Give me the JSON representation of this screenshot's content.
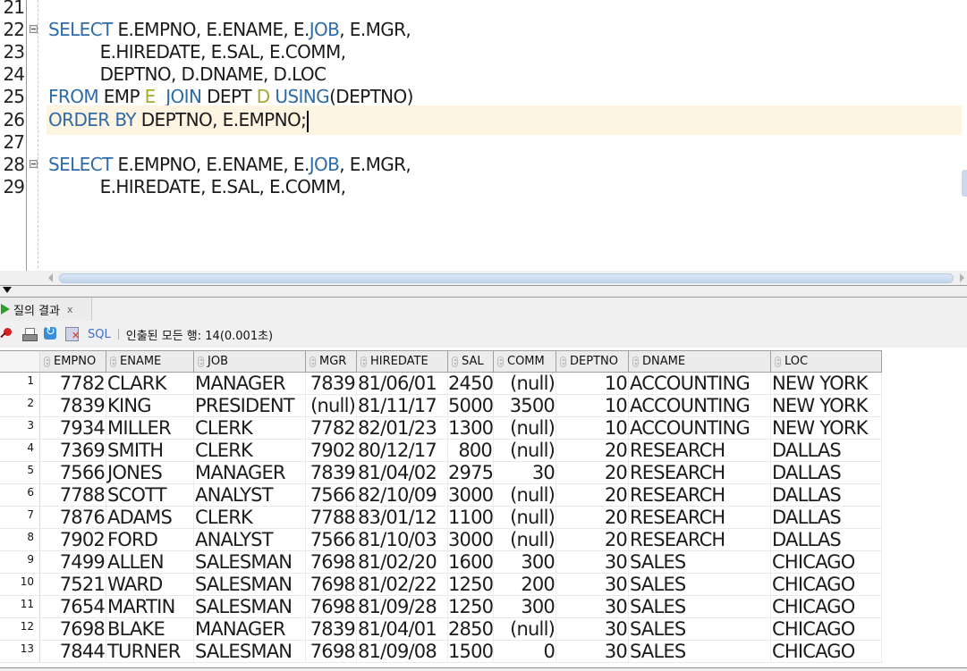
{
  "editor": {
    "lines": [
      {
        "no": "21",
        "fold": false,
        "tokens": []
      },
      {
        "no": "22",
        "fold": true,
        "tokens": [
          {
            "t": "SELECT",
            "k": "kw"
          },
          {
            "t": " E.EMPNO, E.ENAME, E.",
            "k": ""
          },
          {
            "t": "JOB",
            "k": "kw"
          },
          {
            "t": ", E.MGR,",
            "k": ""
          }
        ]
      },
      {
        "no": "23",
        "fold": false,
        "tokens": [
          {
            "t": "          E.HIREDATE, E.SAL, E.COMM,",
            "k": ""
          }
        ]
      },
      {
        "no": "24",
        "fold": false,
        "tokens": [
          {
            "t": "          DEPTNO, D.DNAME, D.LOC",
            "k": ""
          }
        ]
      },
      {
        "no": "25",
        "fold": false,
        "tokens": [
          {
            "t": "FROM",
            "k": "kw"
          },
          {
            "t": " EMP ",
            "k": ""
          },
          {
            "t": "E",
            "k": "alias"
          },
          {
            "t": "  ",
            "k": ""
          },
          {
            "t": "JOIN",
            "k": "kw"
          },
          {
            "t": " DEPT ",
            "k": ""
          },
          {
            "t": "D",
            "k": "alias"
          },
          {
            "t": " ",
            "k": ""
          },
          {
            "t": "USING",
            "k": "kw"
          },
          {
            "t": "(DEPTNO)",
            "k": ""
          }
        ]
      },
      {
        "no": "26",
        "fold": false,
        "current": true,
        "tokens": [
          {
            "t": "ORDER BY",
            "k": "kw"
          },
          {
            "t": " DEPTNO, E.EMPNO;",
            "k": ""
          }
        ]
      },
      {
        "no": "27",
        "fold": false,
        "tokens": []
      },
      {
        "no": "28",
        "fold": true,
        "tokens": [
          {
            "t": "SELECT",
            "k": "kw"
          },
          {
            "t": " E.EMPNO, E.ENAME, E.",
            "k": ""
          },
          {
            "t": "JOB",
            "k": "kw"
          },
          {
            "t": ", E.MGR,",
            "k": ""
          }
        ]
      },
      {
        "no": "29",
        "fold": false,
        "tokens": [
          {
            "t": "          E.HIREDATE, E.SAL, E.COMM,",
            "k": ""
          }
        ]
      }
    ]
  },
  "results": {
    "tab_label": "질의 결과",
    "tab_close": "x",
    "toolbar": {
      "icons": [
        "pin-icon",
        "print-icon",
        "refresh-icon",
        "cancel-fetch-icon"
      ],
      "sql_label": "SQL",
      "status": "인출된 모든 행: 14(0.001초)"
    },
    "columns": [
      "EMPNO",
      "ENAME",
      "JOB",
      "MGR",
      "HIREDATE",
      "SAL",
      "COMM",
      "DEPTNO",
      "DNAME",
      "LOC"
    ],
    "column_align": [
      "num",
      "txt",
      "txt",
      "num",
      "txt",
      "num",
      "num",
      "num",
      "txt",
      "txt"
    ],
    "rows": [
      [
        "1",
        "7782",
        "CLARK",
        "MANAGER",
        "7839",
        "81/06/01",
        "2450",
        "(null)",
        "10",
        "ACCOUNTING",
        "NEW YORK"
      ],
      [
        "2",
        "7839",
        "KING",
        "PRESIDENT",
        "(null)",
        "81/11/17",
        "5000",
        "3500",
        "10",
        "ACCOUNTING",
        "NEW YORK"
      ],
      [
        "3",
        "7934",
        "MILLER",
        "CLERK",
        "7782",
        "82/01/23",
        "1300",
        "(null)",
        "10",
        "ACCOUNTING",
        "NEW YORK"
      ],
      [
        "4",
        "7369",
        "SMITH",
        "CLERK",
        "7902",
        "80/12/17",
        "800",
        "(null)",
        "20",
        "RESEARCH",
        "DALLAS"
      ],
      [
        "5",
        "7566",
        "JONES",
        "MANAGER",
        "7839",
        "81/04/02",
        "2975",
        "30",
        "20",
        "RESEARCH",
        "DALLAS"
      ],
      [
        "6",
        "7788",
        "SCOTT",
        "ANALYST",
        "7566",
        "82/10/09",
        "3000",
        "(null)",
        "20",
        "RESEARCH",
        "DALLAS"
      ],
      [
        "7",
        "7876",
        "ADAMS",
        "CLERK",
        "7788",
        "83/01/12",
        "1100",
        "(null)",
        "20",
        "RESEARCH",
        "DALLAS"
      ],
      [
        "8",
        "7902",
        "FORD",
        "ANALYST",
        "7566",
        "81/10/03",
        "3000",
        "(null)",
        "20",
        "RESEARCH",
        "DALLAS"
      ],
      [
        "9",
        "7499",
        "ALLEN",
        "SALESMAN",
        "7698",
        "81/02/20",
        "1600",
        "300",
        "30",
        "SALES",
        "CHICAGO"
      ],
      [
        "10",
        "7521",
        "WARD",
        "SALESMAN",
        "7698",
        "81/02/22",
        "1250",
        "200",
        "30",
        "SALES",
        "CHICAGO"
      ],
      [
        "11",
        "7654",
        "MARTIN",
        "SALESMAN",
        "7698",
        "81/09/28",
        "1250",
        "300",
        "30",
        "SALES",
        "CHICAGO"
      ],
      [
        "12",
        "7698",
        "BLAKE",
        "MANAGER",
        "7839",
        "81/04/01",
        "2850",
        "(null)",
        "30",
        "SALES",
        "CHICAGO"
      ],
      [
        "13",
        "7844",
        "TURNER",
        "SALESMAN",
        "7698",
        "81/09/08",
        "1500",
        "0",
        "30",
        "SALES",
        "CHICAGO"
      ]
    ]
  },
  "colors": {
    "keyword": "#2e6ba8",
    "alias": "#a8a830",
    "current_line": "#fdf4e1",
    "run_icon": "#2aa02a",
    "sql_link": "#3b6fc9"
  }
}
